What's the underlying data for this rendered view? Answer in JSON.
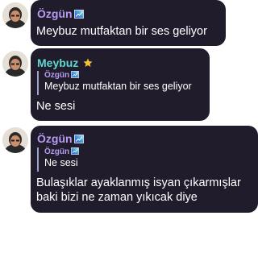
{
  "colors": {
    "bubble_bg": "#211c2b",
    "ozgun_name": "#b69cf2",
    "meybuz_name": "#5fd9cf",
    "star": "#f4c430",
    "text": "#ffffff"
  },
  "messages": [
    {
      "author": "Özgün",
      "author_icon": "gradient-badge-icon",
      "text": "Meybuz mutfaktan bir ses geliyor"
    },
    {
      "author": "Meybuz",
      "author_icon": "star-icon",
      "reply": {
        "author": "Özgün",
        "author_icon": "gradient-badge-icon",
        "text": "Meybuz mutfaktan bir ses geliyor"
      },
      "text": "Ne sesi"
    },
    {
      "author": "Özgün",
      "author_icon": "gradient-badge-icon",
      "reply": {
        "author": "Özgün",
        "author_icon": "gradient-badge-icon",
        "text": "Ne sesi"
      },
      "text_lines": [
        "Bulaşıklar ayaklanmış isyan çıkarmışlar",
        "baki bizi ne zaman yıkıcak diye"
      ]
    }
  ]
}
